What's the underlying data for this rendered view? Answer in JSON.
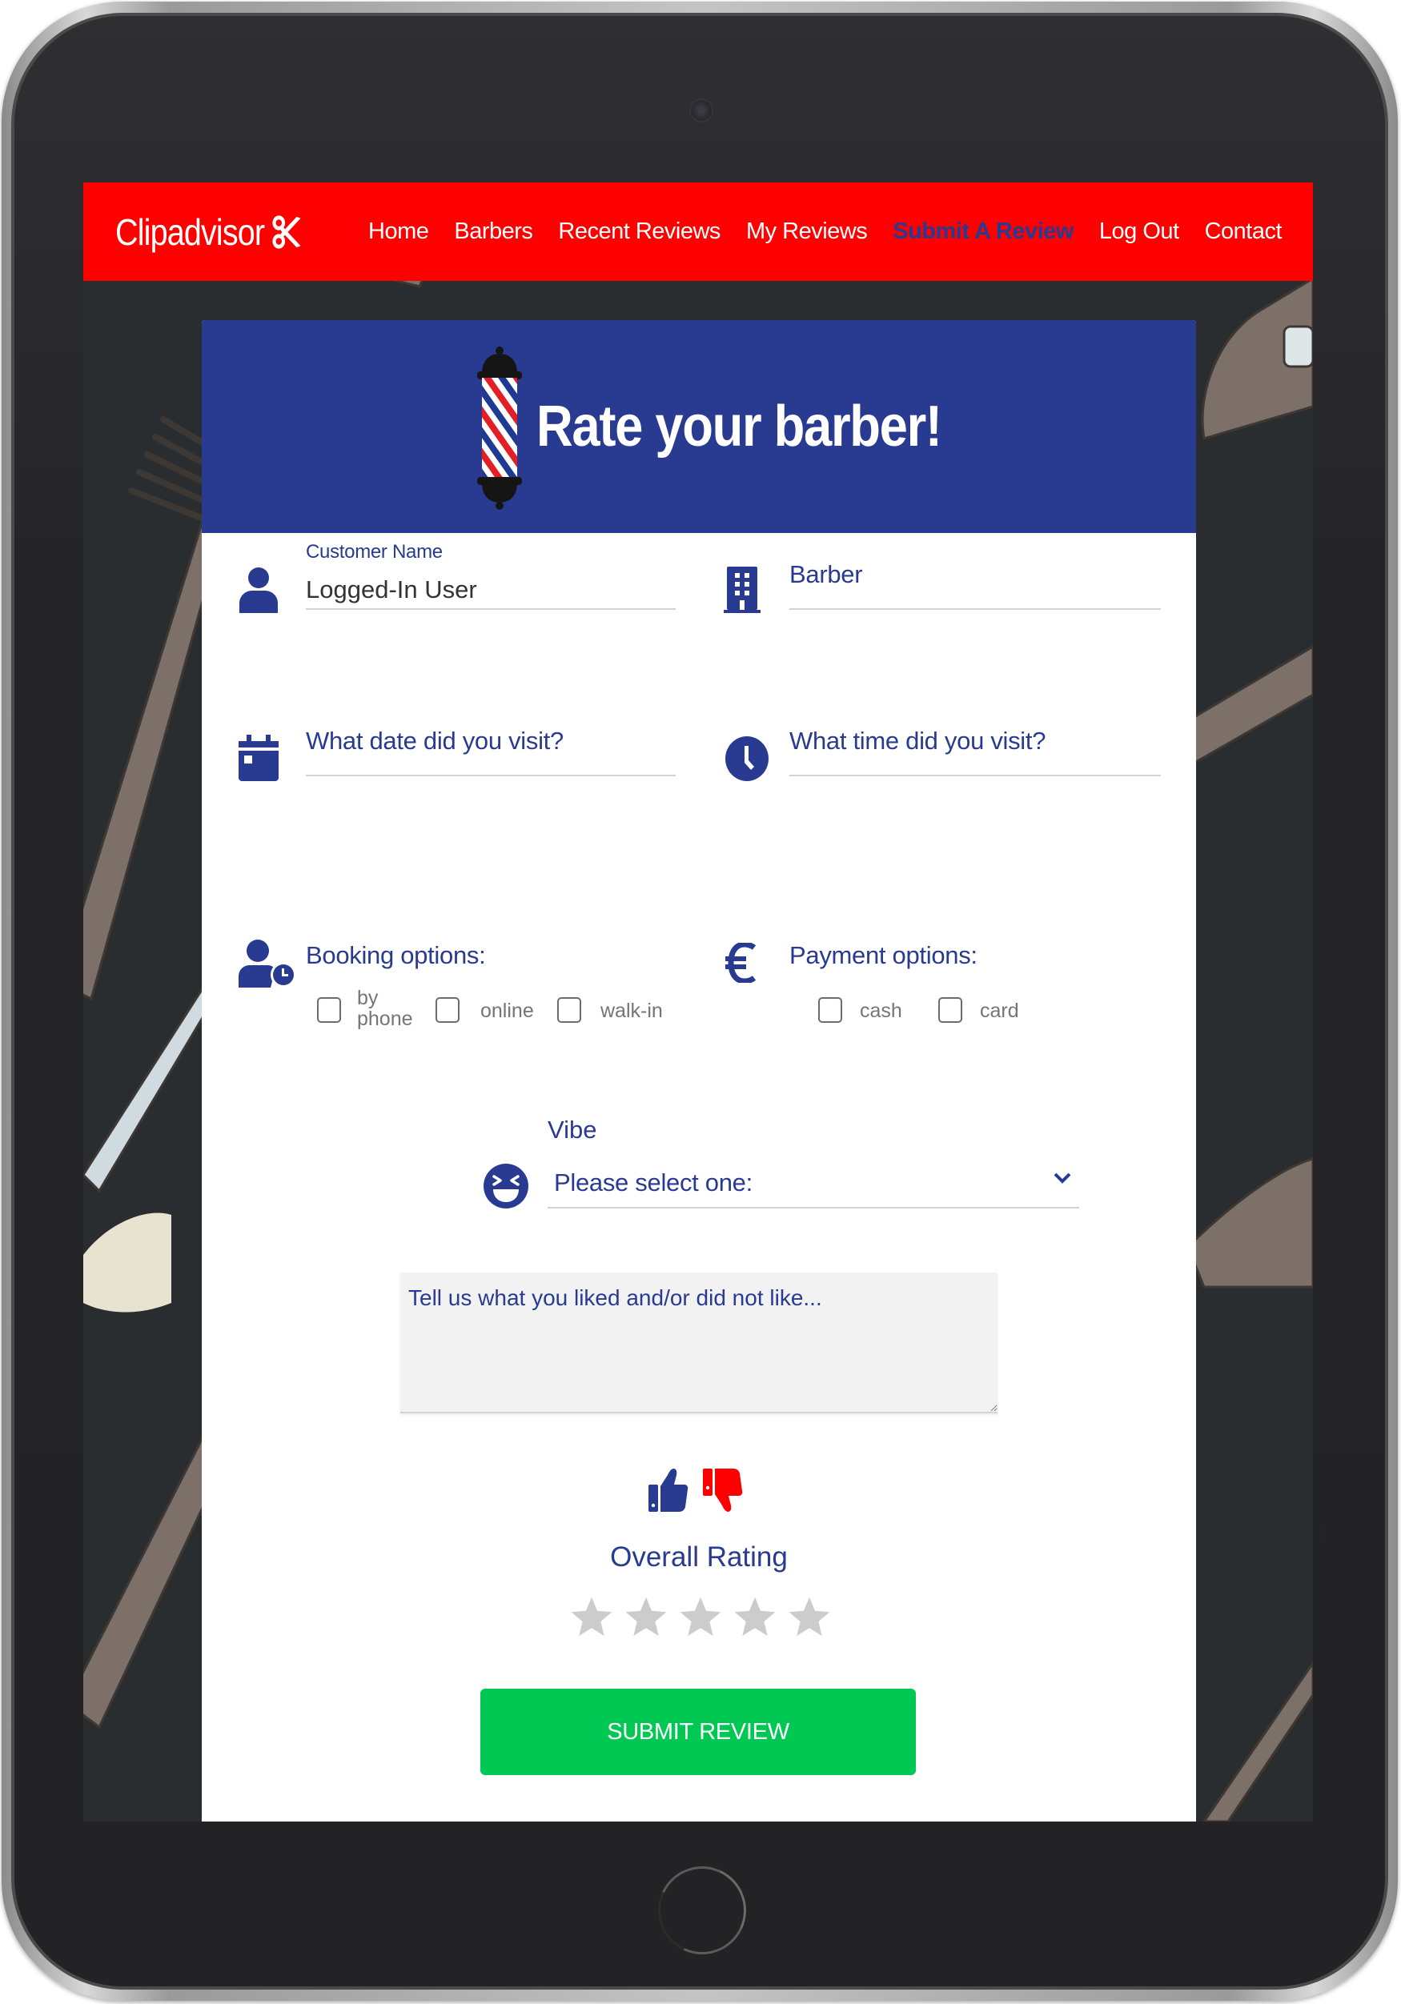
{
  "navbar": {
    "brand": "Clipadvisor",
    "brand_icon": "scissors-icon",
    "background_color": "#FF0000",
    "active_color": "#283B91",
    "links": [
      {
        "label": "Home",
        "active": false
      },
      {
        "label": "Barbers",
        "active": false
      },
      {
        "label": "Recent Reviews",
        "active": false
      },
      {
        "label": "My Reviews",
        "active": false
      },
      {
        "label": "Submit A Review",
        "active": true
      },
      {
        "label": "Log Out",
        "active": false
      },
      {
        "label": "Contact",
        "active": false
      }
    ]
  },
  "card": {
    "header_color": "#283B91",
    "title": "Rate your barber!",
    "title_icon": "barber-pole-icon"
  },
  "form": {
    "customer_name": {
      "label": "Customer Name",
      "value": "Logged-In User",
      "icon": "user-icon"
    },
    "barber": {
      "placeholder": "Barber",
      "value": "",
      "icon": "building-icon"
    },
    "visit_date": {
      "placeholder": "What date did you visit?",
      "value": "",
      "icon": "calendar-icon"
    },
    "visit_time": {
      "placeholder": "What time did you visit?",
      "value": "",
      "icon": "clock-icon"
    },
    "booking": {
      "label": "Booking options:",
      "icon": "user-clock-icon",
      "options": [
        {
          "label_line1": "by",
          "label_line2": "phone",
          "checked": false
        },
        {
          "label_line1": "online",
          "label_line2": "",
          "checked": false
        },
        {
          "label_line1": "walk-in",
          "label_line2": "",
          "checked": false
        }
      ]
    },
    "payment": {
      "label": "Payment options:",
      "icon": "euro-icon",
      "options": [
        {
          "label": "cash",
          "checked": false
        },
        {
          "label": "card",
          "checked": false
        }
      ]
    },
    "vibe": {
      "label": "Vibe",
      "icon": "laughing-face-icon",
      "selected": "Please select one:"
    },
    "comments": {
      "placeholder": "Tell us what you liked and/or did not like...",
      "value": ""
    },
    "thumbs": {
      "up_color": "#283B91",
      "down_color": "#FF0000"
    },
    "rating": {
      "label": "Overall Rating",
      "max_stars": 5,
      "value": 0,
      "empty_color": "#CCCCCC"
    },
    "submit_label": "SUBMIT REVIEW",
    "submit_color": "#00C853"
  }
}
